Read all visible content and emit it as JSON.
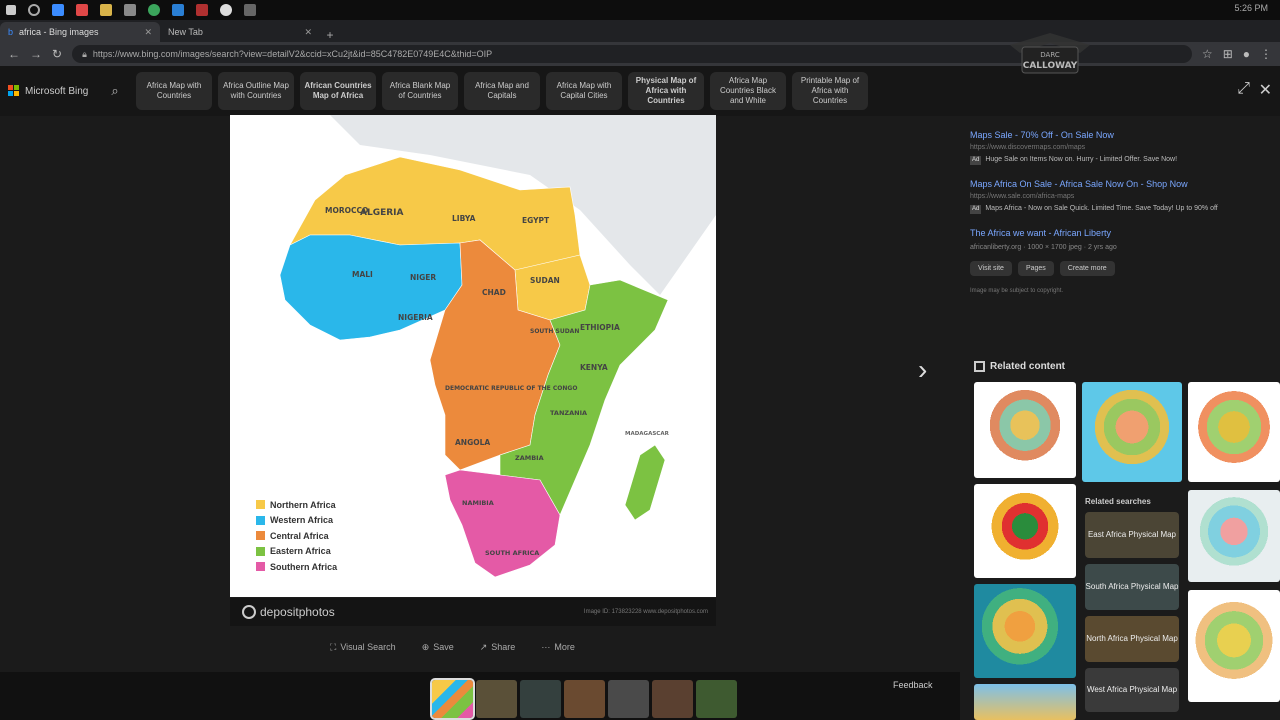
{
  "browser": {
    "tabs": [
      {
        "label": "africa - Bing images"
      },
      {
        "label": "New Tab"
      }
    ],
    "url": "https://www.bing.com/images/search?view=detailV2&ccid=xCu2jt&id=85C4782E0749E4C&thid=OIP",
    "clock": "5:26 PM"
  },
  "bing": {
    "logo_text": "Microsoft Bing",
    "chips": [
      {
        "label": "Africa Map with Countries"
      },
      {
        "label": "Africa Outline Map with Countries"
      },
      {
        "label": "African Countries Map of Africa"
      },
      {
        "label": "Africa Blank Map of Countries"
      },
      {
        "label": "Africa Map and Capitals"
      },
      {
        "label": "Africa Map with Capital Cities"
      },
      {
        "label": "Physical Map of Africa with Countries"
      },
      {
        "label": "Africa Map Countries Black and White"
      },
      {
        "label": "Printable Map of Africa with Countries"
      }
    ]
  },
  "image": {
    "legend": [
      {
        "label": "Northern Africa",
        "color": "#f7c948"
      },
      {
        "label": "Western Africa",
        "color": "#2ab7ea"
      },
      {
        "label": "Central Africa",
        "color": "#ec8a3c"
      },
      {
        "label": "Eastern Africa",
        "color": "#7cc242"
      },
      {
        "label": "Southern Africa",
        "color": "#e45aa6"
      }
    ],
    "map_labels": {
      "morocco": "MOROCCO",
      "algeria": "ALGERIA",
      "libya": "LIBYA",
      "egypt": "EGYPT",
      "mali": "MALI",
      "niger": "NIGER",
      "chad": "CHAD",
      "sudan": "SUDAN",
      "nigeria": "NIGERIA",
      "ethiopia": "ETHIOPIA",
      "south_sudan": "SOUTH SUDAN",
      "kenya": "KENYA",
      "drc": "DEMOCRATIC REPUBLIC OF THE CONGO",
      "tanzania": "TANZANIA",
      "angola": "ANGOLA",
      "zambia": "ZAMBIA",
      "namibia": "NAMIBIA",
      "south_africa": "SOUTH AFRICA",
      "madagascar": "MADAGASCAR"
    },
    "source": "depositphotos",
    "credit": "Image ID: 173823228 www.depositphotos.com"
  },
  "actions": [
    {
      "icon": "visual-search-icon",
      "label": "Visual Search"
    },
    {
      "icon": "save-icon",
      "label": "Save"
    },
    {
      "icon": "share-icon",
      "label": "Share"
    },
    {
      "icon": "more-icon",
      "label": "More"
    }
  ],
  "feedback": "Feedback",
  "sidebar": {
    "ads": [
      {
        "title": "Maps Sale - 70% Off - On Sale Now",
        "url": "https://www.discovermaps.com/maps",
        "desc": "Huge Sale on Items Now on. Hurry - Limited Offer. Save Now!"
      },
      {
        "title": "Maps Africa On Sale - Africa Sale Now On - Shop Now",
        "url": "https://www.sale.com/africa-maps",
        "desc": "Maps Africa - Now on Sale Quick. Limited Time. Save Today! Up to 90% off"
      }
    ],
    "result": {
      "title": "The Africa we want - African Liberty",
      "meta": "africanliberty.org · 1000 × 1700 jpeg · 2 yrs ago",
      "buttons": [
        "Visit site",
        "Pages",
        "Create more"
      ],
      "copyright": "Image may be subject to copyright."
    },
    "related_title": "Related content",
    "related_searches_title": "Related searches",
    "related_searches": [
      {
        "label": "East Africa Physical Map"
      },
      {
        "label": "South Africa Physical Map"
      },
      {
        "label": "North Africa Physical Map"
      },
      {
        "label": "West Africa Physical Map"
      }
    ]
  },
  "overlay": {
    "brand_line1": "DARC",
    "brand_line2": "CALLOWAY"
  }
}
